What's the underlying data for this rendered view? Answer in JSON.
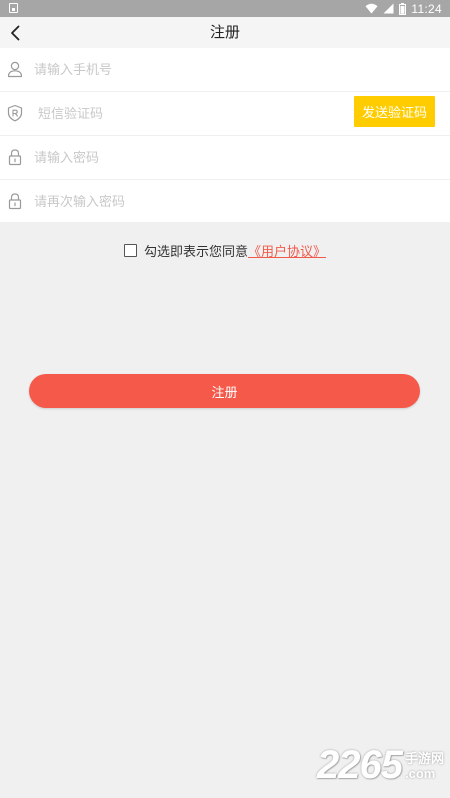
{
  "status_bar": {
    "time": "11:24",
    "icons": [
      "notification-icon",
      "wifi-icon",
      "signal-icon",
      "battery-icon"
    ]
  },
  "header": {
    "title": "注册",
    "back_icon": "chevron-left-icon"
  },
  "form": {
    "phone": {
      "placeholder": "请输入手机号",
      "value": "",
      "icon": "user-icon"
    },
    "sms_code": {
      "placeholder": "短信验证码",
      "value": "",
      "icon": "shield-icon"
    },
    "send_code_label": "发送验证码",
    "password": {
      "placeholder": "请输入密码",
      "value": "",
      "icon": "lock-icon"
    },
    "confirm_password": {
      "placeholder": "请再次输入密码",
      "value": "",
      "icon": "lock-icon"
    }
  },
  "agreement": {
    "text": "勾选即表示您同意",
    "link": "《用户协议》",
    "checked": false
  },
  "register_button": "注册",
  "watermark": {
    "number": "2265",
    "cn": "手游网",
    "domain": ".com"
  },
  "colors": {
    "accent": "#f5594a",
    "send_code_bg": "#ffcc00",
    "link": "#f15a4a",
    "status_bar": "#a6a6a6",
    "background": "#f0f0f0"
  }
}
